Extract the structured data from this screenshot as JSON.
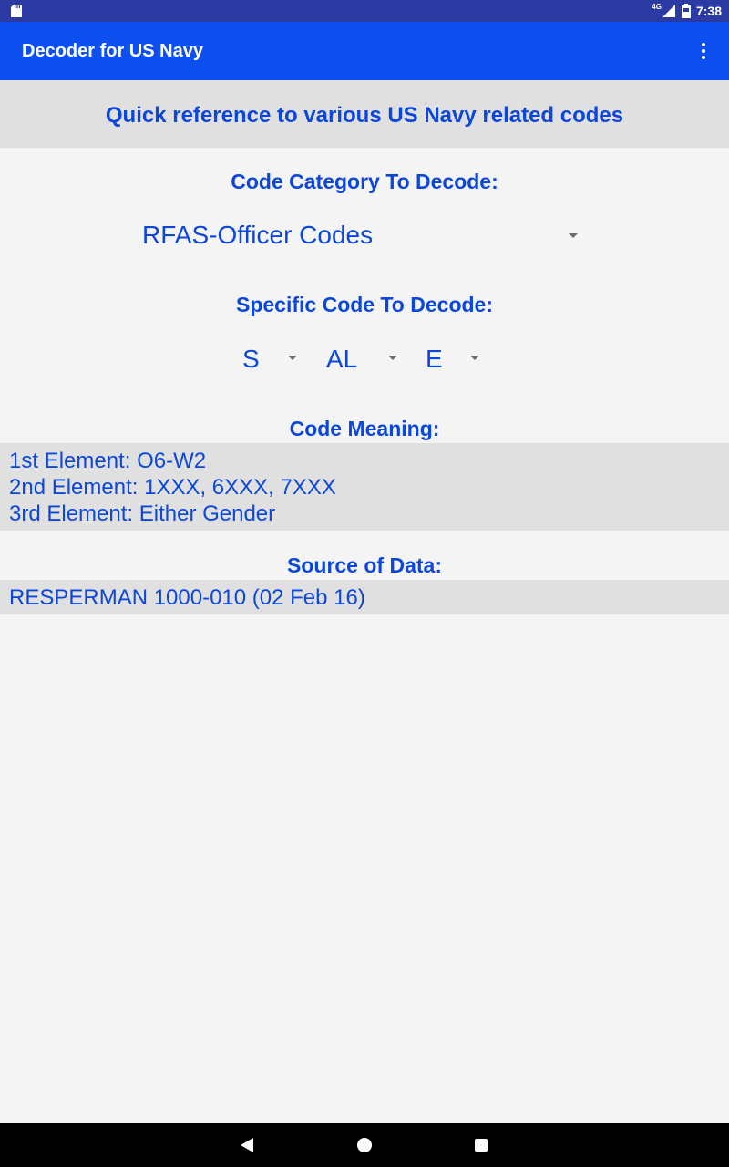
{
  "status_bar": {
    "network": "4G",
    "time": "7:38",
    "icons": [
      "sd-card-icon",
      "signal-icon",
      "battery-icon"
    ]
  },
  "app_bar": {
    "title": "Decoder for US Navy",
    "menu_icon": "more-vert-icon"
  },
  "banner": {
    "text": "Quick reference to various US Navy related codes"
  },
  "category": {
    "label": "Code Category To Decode:",
    "selected": "RFAS-Officer Codes"
  },
  "specific": {
    "label": "Specific Code To Decode:",
    "elements": [
      {
        "selected": "S"
      },
      {
        "selected": "AL"
      },
      {
        "selected": "E"
      }
    ]
  },
  "meaning": {
    "label": "Code Meaning:",
    "lines": [
      "1st Element: O6-W2",
      "2nd Element: 1XXX, 6XXX, 7XXX",
      "3rd Element: Either Gender"
    ]
  },
  "source": {
    "label": "Source of Data:",
    "text": "RESPERMAN 1000-010 (02 Feb 16)"
  },
  "nav_bar": {
    "buttons": [
      "back-icon",
      "home-icon",
      "recents-icon"
    ]
  },
  "colors": {
    "status_bar": "#2c3aa3",
    "app_bar": "#0e4ff0",
    "accent_text": "#0d47d9",
    "panel_bg": "#e0e0e0",
    "page_bg": "#f4f4f4"
  }
}
